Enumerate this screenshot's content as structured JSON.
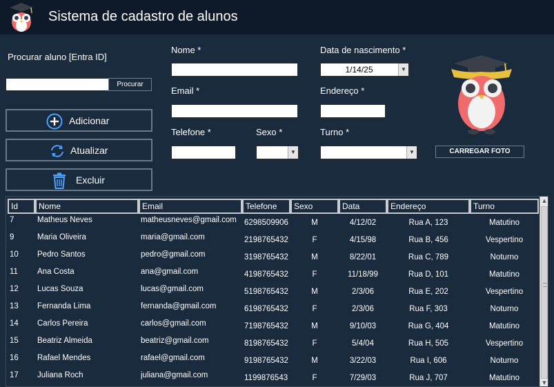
{
  "window": {
    "title": "Sistema de cadastro de alunos",
    "logo_icon": "owl-logo-icon"
  },
  "search": {
    "label": "Procurar aluno [Entra ID]",
    "value": "",
    "button_label": "Procurar"
  },
  "form": {
    "nome_label": "Nome *",
    "nome_value": "",
    "data_label": "Data de nascimento *",
    "data_value": "1/14/25",
    "email_label": "Email *",
    "email_value": "",
    "endereco_label": "Endereço *",
    "endereco_value": "",
    "telefone_label": "Telefone *",
    "telefone_value": "",
    "sexo_label": "Sexo *",
    "sexo_value": "",
    "turno_label": "Turno *",
    "turno_value": "",
    "photo_button_label": "CARREGAR FOTO",
    "photo_icon": "owl-graduate-icon"
  },
  "actions": {
    "add_label": "Adicionar",
    "add_icon": "plus-circle-icon",
    "update_label": "Atualizar",
    "update_icon": "refresh-icon",
    "delete_label": "Excluir",
    "delete_icon": "trash-icon"
  },
  "table": {
    "headers": [
      "Id",
      "Nome",
      "Email",
      "Telefone",
      "Sexo",
      "Data",
      "Endereço",
      "Turno"
    ],
    "rows": [
      {
        "id": "7",
        "nome": "Matheus  Neves",
        "email": "matheusneves@gmail.com",
        "telefone": "6298509906",
        "sexo": "M",
        "data": "4/12/02",
        "endereco": "Rua A, 123",
        "turno": "Matutino"
      },
      {
        "id": "9",
        "nome": "Maria Oliveira",
        "email": "maria@gmail.com",
        "telefone": "2198765432",
        "sexo": "F",
        "data": "4/15/98",
        "endereco": "Rua B, 456",
        "turno": "Vespertino"
      },
      {
        "id": "10",
        "nome": "Pedro Santos",
        "email": "pedro@gmail.com",
        "telefone": "3198765432",
        "sexo": "M",
        "data": "8/22/01",
        "endereco": "Rua C, 789",
        "turno": "Noturno"
      },
      {
        "id": "11",
        "nome": "Ana Costa",
        "email": "ana@gmail.com",
        "telefone": "4198765432",
        "sexo": "F",
        "data": "11/18/99",
        "endereco": "Rua D, 101",
        "turno": "Matutino"
      },
      {
        "id": "12",
        "nome": "Lucas Souza",
        "email": "lucas@gmail.com",
        "telefone": "5198765432",
        "sexo": "M",
        "data": "2/3/06",
        "endereco": "Rua E, 202",
        "turno": "Vespertino"
      },
      {
        "id": "13",
        "nome": "Fernanda Lima",
        "email": "fernanda@gmail.com",
        "telefone": "6198765432",
        "sexo": "F",
        "data": "2/3/06",
        "endereco": "Rua F, 303",
        "turno": "Noturno"
      },
      {
        "id": "14",
        "nome": "Carlos Pereira",
        "email": "carlos@gmail.com",
        "telefone": "7198765432",
        "sexo": "M",
        "data": "9/10/03",
        "endereco": "Rua G, 404",
        "turno": "Matutino"
      },
      {
        "id": "15",
        "nome": "Beatriz Almeida",
        "email": "beatriz@gmail.com",
        "telefone": "8198765432",
        "sexo": "F",
        "data": "5/4/04",
        "endereco": "Rua H, 505",
        "turno": "Vespertino"
      },
      {
        "id": "16",
        "nome": "Rafael Mendes",
        "email": "rafael@gmail.com",
        "telefone": "9198765432",
        "sexo": "M",
        "data": "3/22/03",
        "endereco": "Rua I, 606",
        "turno": "Noturno"
      },
      {
        "id": "17",
        "nome": "Juliana Roch",
        "email": "juliana@gmail.com",
        "telefone": "1199876543",
        "sexo": "F",
        "data": "7/29/03",
        "endereco": "Rua J, 707",
        "turno": "Matutino"
      }
    ]
  },
  "colors": {
    "background": "#1b2b3e",
    "titlebar": "#0e1a29",
    "owl_body": "#f06b6b",
    "accent_blue": "#4aa3ff"
  }
}
